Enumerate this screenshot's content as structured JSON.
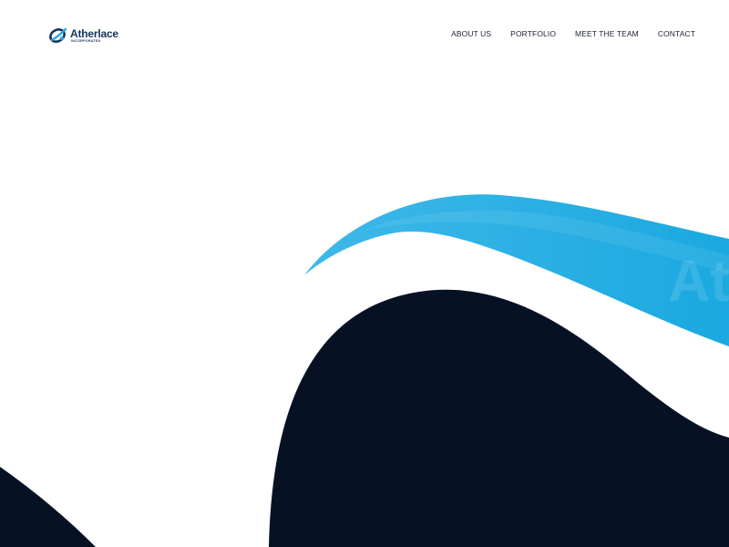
{
  "brand": {
    "name": "Atherlace",
    "subtitle": "INCORPORATED",
    "logo_icon": "atherlace-logo-icon"
  },
  "nav": {
    "items": [
      {
        "label": "ABOUT US"
      },
      {
        "label": "PORTFOLIO"
      },
      {
        "label": "MEET THE TEAM"
      },
      {
        "label": "CONTACT"
      }
    ]
  },
  "hero": {
    "watermark_text": "At"
  },
  "colors": {
    "navy": "#061224",
    "sky_blue": "#31b4e6",
    "brand_blue": "#16335f",
    "nav_text": "#1a2233",
    "background": "#ffffff"
  }
}
